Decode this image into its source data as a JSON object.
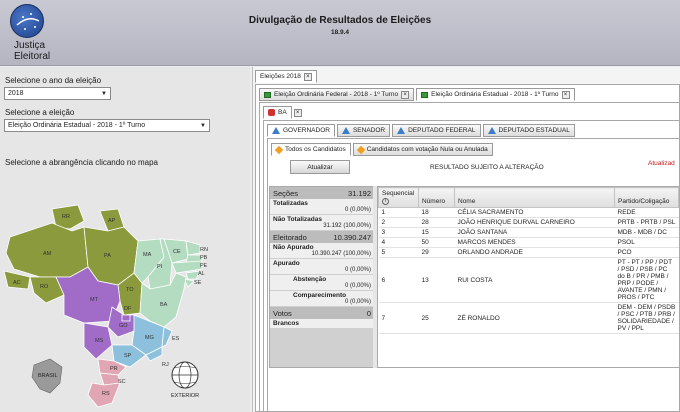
{
  "header": {
    "logo_text": [
      "Justiça",
      "Eleitoral"
    ],
    "title": "Divulgação de Resultados de Eleições",
    "version": "18.9.4"
  },
  "left": {
    "year_label": "Selecione o ano da eleição",
    "year_value": "2018",
    "election_label": "Selecione a eleição",
    "election_value": "Eleição Ordinária Estadual - 2018 - 1º Turno",
    "map_label": "Selecione a abrangência clicando no mapa",
    "states": [
      "RR",
      "AP",
      "AM",
      "PA",
      "MA",
      "CE",
      "RN",
      "PB",
      "PE",
      "AL",
      "SE",
      "PI",
      "AC",
      "RO",
      "TO",
      "BA",
      "MT",
      "DF",
      "GO",
      "MG",
      "ES",
      "MS",
      "SP",
      "RJ",
      "PR",
      "SC",
      "RS"
    ],
    "brasil_label": "BRASIL",
    "exterior_label": "EXTERIOR"
  },
  "tabs": {
    "top": "Eleições 2018",
    "elections": [
      "Eleição Ordinária Federal - 2018 - 1º Turno",
      "Eleição Ordinária Estadual - 2018 - 1º Turno"
    ],
    "state": "BA",
    "offices": [
      "GOVERNADOR",
      "SENADOR",
      "DEPUTADO FEDERAL",
      "DEPUTADO ESTADUAL"
    ],
    "candidate_filters": [
      "Todos os Candidatos",
      "Candidatos com votação Nula ou Anulada"
    ]
  },
  "toolbar": {
    "update_button": "Atualizar",
    "notice": "RESULTADO SUJEITO A ALTERAÇÃO",
    "status": "Atualizad"
  },
  "stats": {
    "secoes_label": "Seções",
    "secoes_value": "31.192",
    "totalizadas_label": "Totalizadas",
    "totalizadas_value": "0 (0,00%)",
    "nao_totalizadas_label": "Não Totalizadas",
    "nao_totalizadas_value": "31.192 (100,00%)",
    "eleitorado_label": "Eleitorado",
    "eleitorado_value": "10.390.247",
    "nao_apurado_label": "Não Apurado",
    "nao_apurado_value": "10.390.247 (100,00%)",
    "apurado_label": "Apurado",
    "apurado_value": "0 (0,00%)",
    "abstencao_label": "Abstenção",
    "abstencao_value": "0 (0,00%)",
    "comparecimento_label": "Comparecimento",
    "comparecimento_value": "0 (0,00%)",
    "votos_label": "Votos",
    "votos_value": "0",
    "brancos_label": "Brancos"
  },
  "table": {
    "headers": [
      "Sequencial",
      "Número",
      "Nome",
      "Partido/Coligação"
    ],
    "rows": [
      {
        "seq": "1",
        "num": "18",
        "name": "CÉLIA SACRAMENTO",
        "party": "REDE"
      },
      {
        "seq": "2",
        "num": "28",
        "name": "JOÃO HENRIQUE DURVAL CARNEIRO",
        "party": "PRTB - PRTB / PSL"
      },
      {
        "seq": "3",
        "num": "15",
        "name": "JOÃO SANTANA",
        "party": "MDB - MDB / DC"
      },
      {
        "seq": "4",
        "num": "50",
        "name": "MARCOS MENDES",
        "party": "PSOL"
      },
      {
        "seq": "5",
        "num": "29",
        "name": "ORLANDO ANDRADE",
        "party": "PCO"
      },
      {
        "seq": "6",
        "num": "13",
        "name": "RUI COSTA",
        "party": "PT - PT / PP / PDT / PSD / PSB / PC do B / PR / PMB / PRP / PODE / AVANTE / PMN / PROS / PTC"
      },
      {
        "seq": "7",
        "num": "25",
        "name": "ZÉ RONALDO",
        "party": "DEM - DEM / PSDB / PSC / PTB / PRB / SOLIDARIEDADE / PV / PPL"
      }
    ]
  }
}
